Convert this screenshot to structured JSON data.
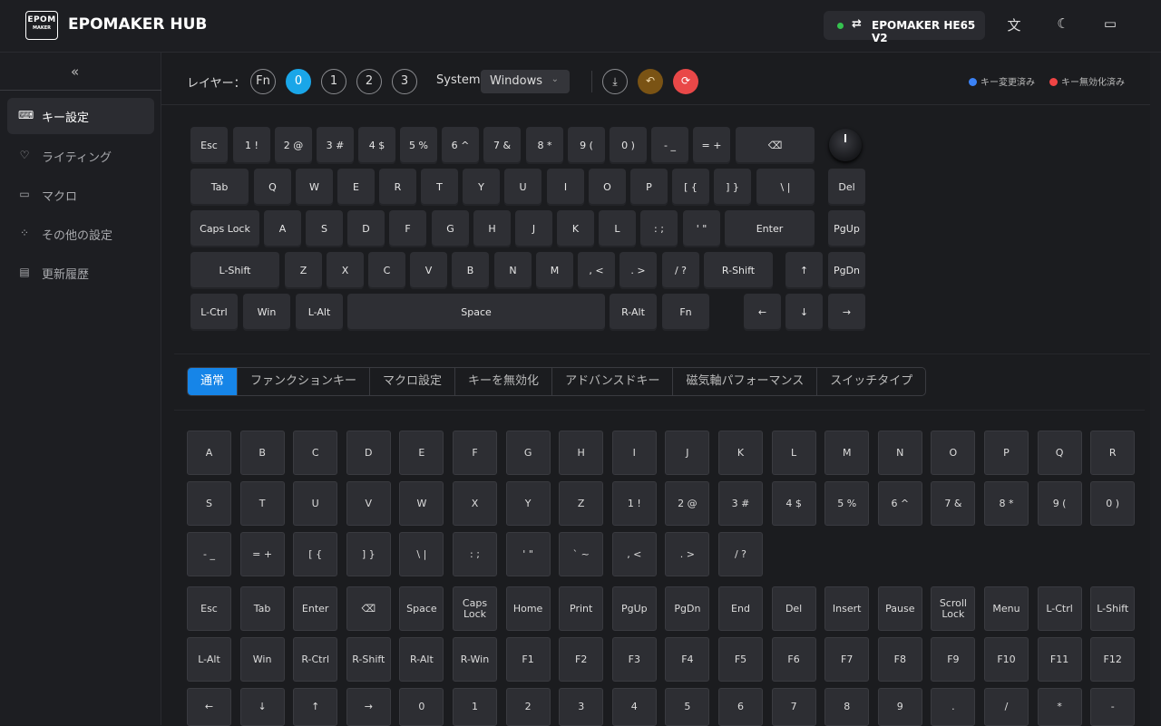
{
  "header": {
    "logo_text": "EPOM",
    "logo_sub": "MAKER",
    "title": "EPOMAKER HUB",
    "device_name": "EPOMAKER HE65 V2",
    "device_status_color": "#35c24f",
    "icons": [
      "translate-icon",
      "moon-icon",
      "message-icon"
    ]
  },
  "sidebar": {
    "collapse_icon": "«",
    "items": [
      {
        "label": "キー設定",
        "icon": "keyboard-icon",
        "glyph": "⌨",
        "active": true
      },
      {
        "label": "ライティング",
        "icon": "bulb-icon",
        "glyph": "♡",
        "active": false
      },
      {
        "label": "マクロ",
        "icon": "terminal-icon",
        "glyph": "▭",
        "active": false
      },
      {
        "label": "その他の設定",
        "icon": "grid-icon",
        "glyph": "⁘",
        "active": false
      },
      {
        "label": "更新履歴",
        "icon": "document-icon",
        "glyph": "▤",
        "active": false
      }
    ]
  },
  "toolbar": {
    "layer_label": "レイヤー：",
    "layers": [
      {
        "label": "Fn",
        "active": false
      },
      {
        "label": "0",
        "active": true
      },
      {
        "label": "1",
        "active": false
      },
      {
        "label": "2",
        "active": false
      },
      {
        "label": "3",
        "active": false
      }
    ],
    "system_label": "System",
    "system_value": "Windows",
    "download_glyph": "⤓",
    "undo_glyph": "↶",
    "reset_glyph": "⟳",
    "legend_modified": "キー変更済み",
    "legend_disabled": "キー無効化済み",
    "colors": {
      "accent": "#1aa6e8",
      "modified": "#3b82f6",
      "disabled": "#ef4444",
      "undo": "#7a5314",
      "reset": "#e94848"
    }
  },
  "keyboard": {
    "rows": [
      [
        "Esc",
        "1 !",
        "2 @",
        "3 #",
        "4 $",
        "5 %",
        "6 ^",
        "7 &",
        "8 *",
        "9 (",
        "0 )",
        "- _",
        "= +",
        "⌫"
      ],
      [
        "Tab",
        "Q",
        "W",
        "E",
        "R",
        "T",
        "Y",
        "U",
        "I",
        "O",
        "P",
        "[ {",
        "] }",
        "\\ |",
        "Del"
      ],
      [
        "Caps Lock",
        "A",
        "S",
        "D",
        "F",
        "G",
        "H",
        "J",
        "K",
        "L",
        ": ;",
        "' \"",
        "Enter",
        "PgUp"
      ],
      [
        "L-Shift",
        "Z",
        "X",
        "C",
        "V",
        "B",
        "N",
        "M",
        ", <",
        ". >",
        "/ ?",
        "R-Shift",
        "↑",
        "PgDn"
      ],
      [
        "L-Ctrl",
        "Win",
        "L-Alt",
        "Space",
        "R-Alt",
        "Fn",
        "←",
        "↓",
        "→"
      ]
    ]
  },
  "tabs": [
    {
      "label": "通常",
      "active": true
    },
    {
      "label": "ファンクションキー",
      "active": false
    },
    {
      "label": "マクロ設定",
      "active": false
    },
    {
      "label": "キーを無効化",
      "active": false
    },
    {
      "label": "アドバンスドキー",
      "active": false
    },
    {
      "label": "磁気軸パフォーマンス",
      "active": false
    },
    {
      "label": "スイッチタイプ",
      "active": false
    }
  ],
  "key_grid": {
    "rows": [
      [
        "A",
        "B",
        "C",
        "D",
        "E",
        "F",
        "G",
        "H",
        "I",
        "J",
        "K",
        "L",
        "M",
        "N",
        "O",
        "P",
        "Q",
        "R"
      ],
      [
        "S",
        "T",
        "U",
        "V",
        "W",
        "X",
        "Y",
        "Z",
        "1 !",
        "2 @",
        "3 #",
        "4 $",
        "5 %",
        "6 ^",
        "7 &",
        "8 *",
        "9 (",
        "0 )"
      ],
      [
        "- _",
        "= +",
        "[ {",
        "] }",
        "\\ |",
        ": ;",
        "' \"",
        "` ~",
        ", <",
        ". >",
        "/ ?"
      ],
      [
        "Esc",
        "Tab",
        "Enter",
        "⌫",
        "Space",
        "Caps Lock",
        "Home",
        "Print",
        "PgUp",
        "PgDn",
        "End",
        "Del",
        "Insert",
        "Pause",
        "Scroll Lock",
        "Menu",
        "L-Ctrl",
        "L-Shift"
      ],
      [
        "L-Alt",
        "Win",
        "R-Ctrl",
        "R-Shift",
        "R-Alt",
        "R-Win",
        "F1",
        "F2",
        "F3",
        "F4",
        "F5",
        "F6",
        "F7",
        "F8",
        "F9",
        "F10",
        "F11",
        "F12"
      ],
      [
        "←",
        "↓",
        "↑",
        "→",
        "0",
        "1",
        "2",
        "3",
        "4",
        "5",
        "6",
        "7",
        "8",
        "9",
        ".",
        "/",
        "*",
        "-"
      ]
    ]
  }
}
